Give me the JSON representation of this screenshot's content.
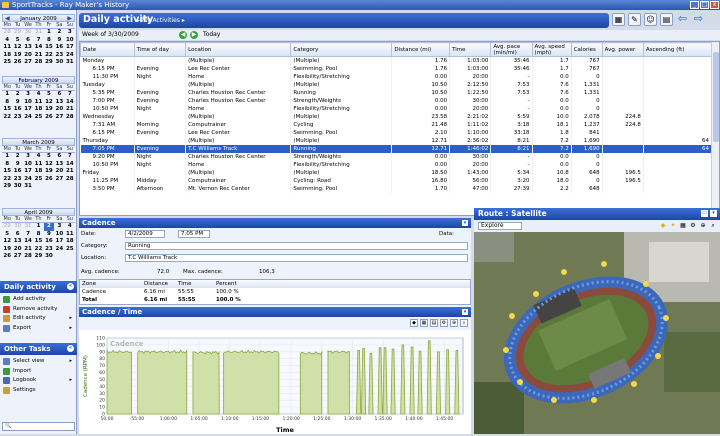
{
  "window": {
    "title": "SportTracks - Ray Maker's History",
    "min": "_",
    "max": "□",
    "close": "x"
  },
  "calendars": [
    {
      "month": "January 2009",
      "top": 4,
      "days": [
        "28",
        "29",
        "30",
        "31",
        "1",
        "2",
        "3",
        "4",
        "5",
        "6",
        "7",
        "8",
        "9",
        "10",
        "11",
        "12",
        "13",
        "14",
        "15",
        "16",
        "17",
        "18",
        "19",
        "20",
        "21",
        "22",
        "23",
        "24",
        "25",
        "26",
        "27",
        "28",
        "29",
        "30",
        "31"
      ],
      "dim_leading": 4
    },
    {
      "month": "February 2009",
      "top": 66,
      "days": [
        "1",
        "2",
        "3",
        "4",
        "5",
        "6",
        "7",
        "8",
        "9",
        "10",
        "11",
        "12",
        "13",
        "14",
        "15",
        "16",
        "17",
        "18",
        "19",
        "20",
        "21",
        "22",
        "23",
        "24",
        "25",
        "26",
        "27",
        "28"
      ],
      "dim_leading": 0
    },
    {
      "month": "March 2009",
      "top": 128,
      "days": [
        "1",
        "2",
        "3",
        "4",
        "5",
        "6",
        "7",
        "8",
        "9",
        "10",
        "11",
        "12",
        "13",
        "14",
        "15",
        "16",
        "17",
        "18",
        "19",
        "20",
        "21",
        "22",
        "23",
        "24",
        "25",
        "26",
        "27",
        "28",
        "29",
        "30",
        "31"
      ],
      "dim_leading": 0
    },
    {
      "month": "April 2009",
      "top": 198,
      "days": [
        "29",
        "30",
        "31",
        "1",
        "2",
        "3",
        "4",
        "5",
        "6",
        "7",
        "8",
        "9",
        "10",
        "11",
        "12",
        "13",
        "14",
        "15",
        "16",
        "17",
        "18",
        "19",
        "20",
        "21",
        "22",
        "23",
        "24",
        "25",
        "26",
        "27",
        "28",
        "29",
        "30"
      ],
      "dim_leading": 3
    }
  ],
  "dow": [
    "Mo",
    "Tu",
    "We",
    "Th",
    "Fr",
    "Sa",
    "Su"
  ],
  "sidebar": {
    "daily_header": "Daily activity",
    "daily_tasks": [
      {
        "label": "Add activity",
        "color": "#3a9a3a"
      },
      {
        "label": "Remove activity",
        "color": "#d23a2a"
      },
      {
        "label": "Edit activity",
        "color": "#c89a3a"
      },
      {
        "label": "Export",
        "color": "#5a7ad0"
      }
    ],
    "other_header": "Other Tasks",
    "other_tasks": [
      {
        "label": "Select view",
        "color": "#5a7ad0"
      },
      {
        "label": "Import",
        "color": "#3a9a3a"
      },
      {
        "label": "Logbook",
        "color": "#4a6ab0"
      },
      {
        "label": "Settings",
        "color": "#c8a040"
      }
    ],
    "search_placeholder": "🔍"
  },
  "header": {
    "title": "Daily activity",
    "subtitle": "▸ My Activities ▸"
  },
  "week": {
    "label": "Week of 3/30/2009",
    "today": "Today"
  },
  "table": {
    "columns": [
      "Date",
      "Time of day",
      "Location",
      "Category",
      "Distance (mi)",
      "Time",
      "Avg. pace (min/mi)",
      "Avg. speed (mph)",
      "Calories",
      "Avg. power",
      "Ascending (ft)"
    ],
    "rows": [
      [
        "Monday",
        "",
        "(Multiple)",
        "(Multiple)",
        "1.76",
        "1:03:00",
        "35:46",
        "1.7",
        "767",
        "",
        ""
      ],
      [
        "6:15 PM",
        "Evening",
        "Lee Rec Center",
        "Swimming: Pool",
        "1.76",
        "1:03:00",
        "35:46",
        "1.7",
        "767",
        "",
        ""
      ],
      [
        "11:30 PM",
        "Night",
        "Home",
        "Flexibility/Stretching",
        "0.00",
        "20:00",
        "-",
        "0.0",
        "0",
        "",
        ""
      ],
      [
        "Tuesday",
        "",
        "(Multiple)",
        "(Multiple)",
        "10.50",
        "2:12:50",
        "7:53",
        "7.6",
        "1,331",
        "",
        ""
      ],
      [
        "5:35 PM",
        "Evening",
        "Charles Houston Rec Center",
        "Running",
        "10.50",
        "1:22:50",
        "7:53",
        "7.6",
        "1,331",
        "",
        ""
      ],
      [
        "7:00 PM",
        "Evening",
        "Charles Houston Rec Center",
        "Strength/Weights",
        "0.00",
        "30:00",
        "-",
        "0.0",
        "0",
        "",
        ""
      ],
      [
        "10:50 PM",
        "Night",
        "Home",
        "Flexibility/Stretching",
        "0.00",
        "20:00",
        "-",
        "0.0",
        "0",
        "",
        ""
      ],
      [
        "Wednesday",
        "",
        "(Multiple)",
        "(Multiple)",
        "23.58",
        "2:21:02",
        "5:59",
        "10.0",
        "2,078",
        "224.8",
        ""
      ],
      [
        "7:31 AM",
        "Morning",
        "Computrainer",
        "Cycling",
        "21.48",
        "1:11:02",
        "3:18",
        "18.1",
        "1,237",
        "224.8",
        ""
      ],
      [
        "6:15 PM",
        "Evening",
        "Lee Rec Center",
        "Swimming: Pool",
        "2.10",
        "1:10:00",
        "33:18",
        "1.8",
        "841",
        "",
        ""
      ],
      [
        "Thursday",
        "",
        "(Multiple)",
        "(Multiple)",
        "12.71",
        "2:36:02",
        "8:21",
        "7.2",
        "1,690",
        "",
        "64"
      ],
      [
        "7:05 PM",
        "Evening",
        "T.C Williams Track",
        "Running",
        "12.71",
        "1:46:02",
        "8:21",
        "7.2",
        "1,690",
        "",
        "64"
      ],
      [
        "9:20 PM",
        "Night",
        "Charles Houston Rec Center",
        "Strength/Weights",
        "0.00",
        "30:00",
        "-",
        "0.0",
        "0",
        "",
        ""
      ],
      [
        "10:50 PM",
        "Night",
        "Home",
        "Flexibility/Stretching",
        "0.00",
        "20:00",
        "-",
        "0.0",
        "0",
        "",
        ""
      ],
      [
        "Friday",
        "",
        "(Multiple)",
        "(Multiple)",
        "18.50",
        "1:43:00",
        "5:34",
        "10.8",
        "648",
        "196.5",
        ""
      ],
      [
        "11:25 PM",
        "Midday",
        "Computrainer",
        "Cycling: Road",
        "16.80",
        "56:00",
        "3:20",
        "18.0",
        "0",
        "196.5",
        ""
      ],
      [
        "3:50 PM",
        "Afternoon",
        "Mt. Vernon Rec Center",
        "Swimming: Pool",
        "1.70",
        "47:00",
        "27:39",
        "2.2",
        "648",
        "",
        ""
      ]
    ],
    "selected_row": 11
  },
  "cadence": {
    "header": "Cadence",
    "date_label": "Date:",
    "date": "4/2/2009",
    "time": "7:05 PM",
    "data_label": "Data:",
    "category_label": "Category:",
    "category": "Running",
    "location_label": "Location:",
    "location": "T.C Williams Track",
    "avg_label": "Avg. cadence:",
    "avg": "72.0",
    "max_label": "Max. cadence:",
    "max": "106.3",
    "zone_cols": [
      "Zone",
      "Distance",
      "Time",
      "Percent"
    ],
    "zone_rows": [
      [
        "Cadence",
        "6.16 mi",
        "55:55",
        "100.0 %"
      ],
      [
        "Total",
        "6.16 mi",
        "55:55",
        "100.0 %"
      ]
    ]
  },
  "cadence_time": {
    "header": "Cadence / Time"
  },
  "route": {
    "header": "Route : Satellite",
    "mode": "Explore"
  },
  "chart_data": {
    "type": "area",
    "title": "Cadence",
    "xlabel": "Time",
    "ylabel": "Cadence (RPM)",
    "ylim": [
      0,
      110
    ],
    "yticks": [
      0,
      10,
      20,
      30,
      40,
      50,
      60,
      70,
      80,
      90,
      100,
      110
    ],
    "xticks": [
      "50:00",
      "55:00",
      "1:00:00",
      "1:05:00",
      "1:10:00",
      "1:15:00",
      "1:20:00",
      "1:25:00",
      "1:30:00",
      "1:35:00",
      "1:40:00",
      "1:45:00"
    ],
    "x_min": [
      50,
      108
    ],
    "segments": [
      {
        "start": 50,
        "end": 54.0,
        "level": 90
      },
      {
        "start": 55,
        "end": 63.0,
        "level": 90
      },
      {
        "start": 64,
        "end": 68.3,
        "level": 89
      },
      {
        "start": 69,
        "end": 78.0,
        "level": 90
      },
      {
        "start": 81.5,
        "end": 85.0,
        "level": 88
      },
      {
        "start": 86,
        "end": 89.5,
        "level": 90
      }
    ],
    "spikes": [
      {
        "x": 91.0,
        "level": 92
      },
      {
        "x": 91.8,
        "level": 95
      },
      {
        "x": 93.0,
        "level": 88
      },
      {
        "x": 94.5,
        "level": 96
      },
      {
        "x": 95.3,
        "level": 96
      },
      {
        "x": 96.6,
        "level": 94
      },
      {
        "x": 98.2,
        "level": 100
      },
      {
        "x": 99.7,
        "level": 97
      },
      {
        "x": 101.0,
        "level": 91
      },
      {
        "x": 102.5,
        "level": 106
      },
      {
        "x": 104.0,
        "level": 90
      },
      {
        "x": 105.5,
        "level": 93
      },
      {
        "x": 107.0,
        "level": 92
      }
    ],
    "grid": true,
    "colors": {
      "fill": "#cfe0a8",
      "line": "#8ea83c"
    }
  }
}
